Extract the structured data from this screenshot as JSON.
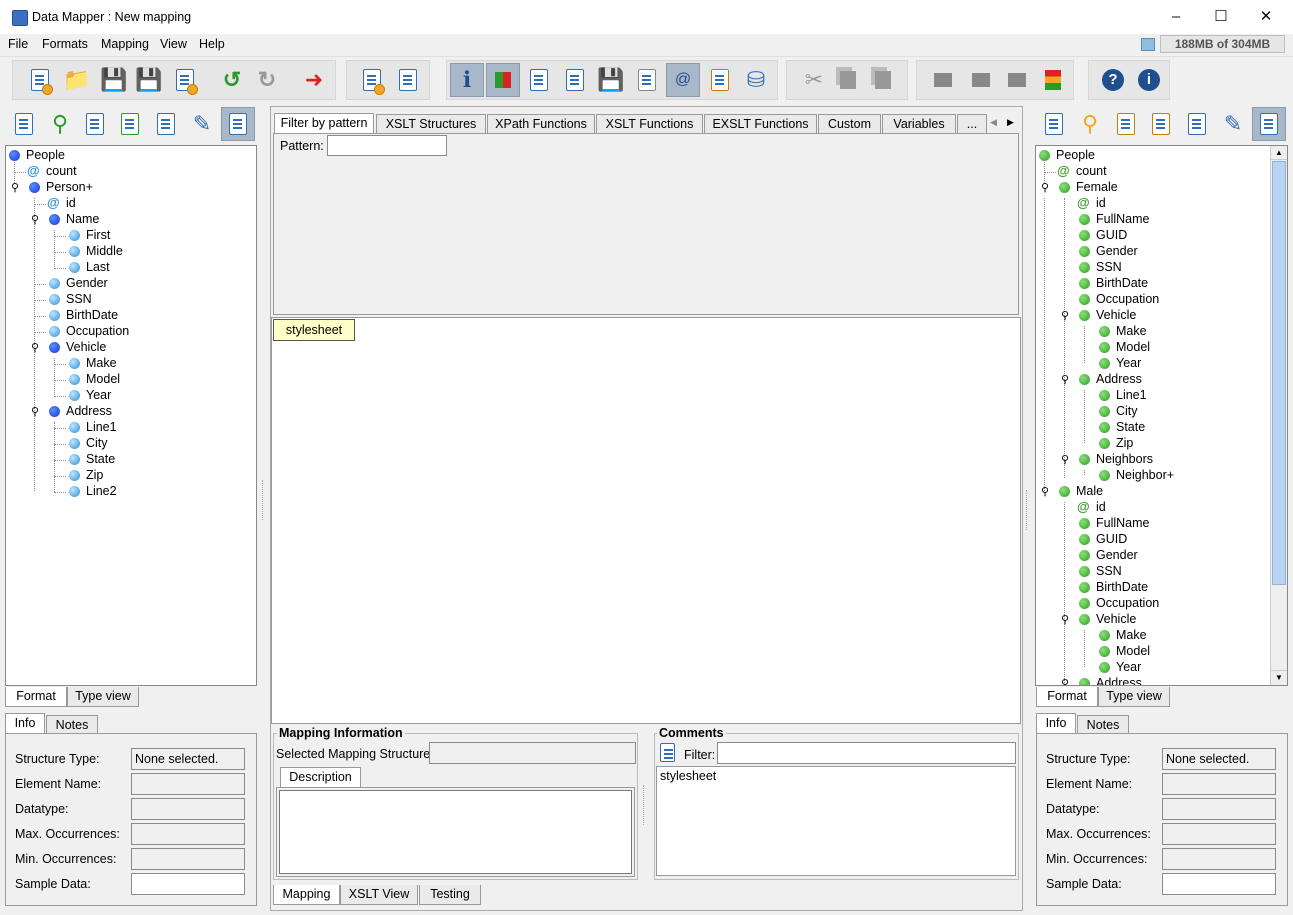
{
  "window": {
    "title": "Data Mapper : New mapping"
  },
  "menu": [
    {
      "label": "File"
    },
    {
      "label": "Formats"
    },
    {
      "label": "Mapping"
    },
    {
      "label": "View"
    },
    {
      "label": "Help"
    }
  ],
  "memory": {
    "label": "188MB of 304MB"
  },
  "left": {
    "tree": [
      {
        "label": "People"
      },
      {
        "label": "count"
      },
      {
        "label": "Person+"
      },
      {
        "label": "id"
      },
      {
        "label": "Name"
      },
      {
        "label": "First"
      },
      {
        "label": "Middle"
      },
      {
        "label": "Last"
      },
      {
        "label": "Gender"
      },
      {
        "label": "SSN"
      },
      {
        "label": "BirthDate"
      },
      {
        "label": "Occupation"
      },
      {
        "label": "Vehicle"
      },
      {
        "label": "Make"
      },
      {
        "label": "Model"
      },
      {
        "label": "Year"
      },
      {
        "label": "Address"
      },
      {
        "label": "Line1"
      },
      {
        "label": "City"
      },
      {
        "label": "State"
      },
      {
        "label": "Zip"
      },
      {
        "label": "Line2"
      }
    ],
    "view_tabs": [
      {
        "label": "Format"
      },
      {
        "label": "Type view"
      }
    ],
    "info_tabs": [
      {
        "label": "Info"
      },
      {
        "label": "Notes"
      }
    ],
    "props": [
      {
        "label": "Structure Type:",
        "value": "None selected."
      },
      {
        "label": "Element Name:",
        "value": ""
      },
      {
        "label": "Datatype:",
        "value": ""
      },
      {
        "label": "Max. Occurrences:",
        "value": ""
      },
      {
        "label": "Min. Occurrences:",
        "value": ""
      },
      {
        "label": "Sample Data:",
        "value": ""
      }
    ]
  },
  "right": {
    "tree": [
      {
        "label": "People"
      },
      {
        "label": "count"
      },
      {
        "label": "Female"
      },
      {
        "label": "id"
      },
      {
        "label": "FullName"
      },
      {
        "label": "GUID"
      },
      {
        "label": "Gender"
      },
      {
        "label": "SSN"
      },
      {
        "label": "BirthDate"
      },
      {
        "label": "Occupation"
      },
      {
        "label": "Vehicle"
      },
      {
        "label": "Make"
      },
      {
        "label": "Model"
      },
      {
        "label": "Year"
      },
      {
        "label": "Address"
      },
      {
        "label": "Line1"
      },
      {
        "label": "City"
      },
      {
        "label": "State"
      },
      {
        "label": "Zip"
      },
      {
        "label": "Neighbors"
      },
      {
        "label": "Neighbor+"
      },
      {
        "label": "Male"
      },
      {
        "label": "id"
      },
      {
        "label": "FullName"
      },
      {
        "label": "GUID"
      },
      {
        "label": "Gender"
      },
      {
        "label": "SSN"
      },
      {
        "label": "BirthDate"
      },
      {
        "label": "Occupation"
      },
      {
        "label": "Vehicle"
      },
      {
        "label": "Make"
      },
      {
        "label": "Model"
      },
      {
        "label": "Year"
      },
      {
        "label": "Address"
      }
    ],
    "view_tabs": [
      {
        "label": "Format"
      },
      {
        "label": "Type view"
      }
    ],
    "info_tabs": [
      {
        "label": "Info"
      },
      {
        "label": "Notes"
      }
    ],
    "props": [
      {
        "label": "Structure Type:",
        "value": "None selected."
      },
      {
        "label": "Element Name:",
        "value": ""
      },
      {
        "label": "Datatype:",
        "value": ""
      },
      {
        "label": "Max. Occurrences:",
        "value": ""
      },
      {
        "label": "Min. Occurrences:",
        "value": ""
      },
      {
        "label": "Sample Data:",
        "value": ""
      }
    ]
  },
  "center": {
    "function_tabs": [
      {
        "label": "Filter by pattern"
      },
      {
        "label": "XSLT Structures"
      },
      {
        "label": "XPath Functions"
      },
      {
        "label": "XSLT Functions"
      },
      {
        "label": "EXSLT Functions"
      },
      {
        "label": "Custom"
      },
      {
        "label": "Variables"
      },
      {
        "label": "..."
      }
    ],
    "pattern_label": "Pattern:",
    "pattern_value": "",
    "stylesheet_node": "stylesheet",
    "mapping_info": {
      "title": "Mapping Information",
      "selected_label": "Selected Mapping Structure:",
      "selected_value": "",
      "description_tab": "Description"
    },
    "comments": {
      "title": "Comments",
      "filter_label": "Filter:",
      "filter_value": "",
      "items": [
        "stylesheet"
      ]
    },
    "bottom_tabs": [
      {
        "label": "Mapping"
      },
      {
        "label": "XSLT View"
      },
      {
        "label": "Testing"
      }
    ]
  },
  "colors": {
    "source_node": "#1536d6",
    "target_node": "#2d9e23",
    "selected_tool": "#a9b8c9",
    "stylesheet_bg": "#ffffc8"
  }
}
